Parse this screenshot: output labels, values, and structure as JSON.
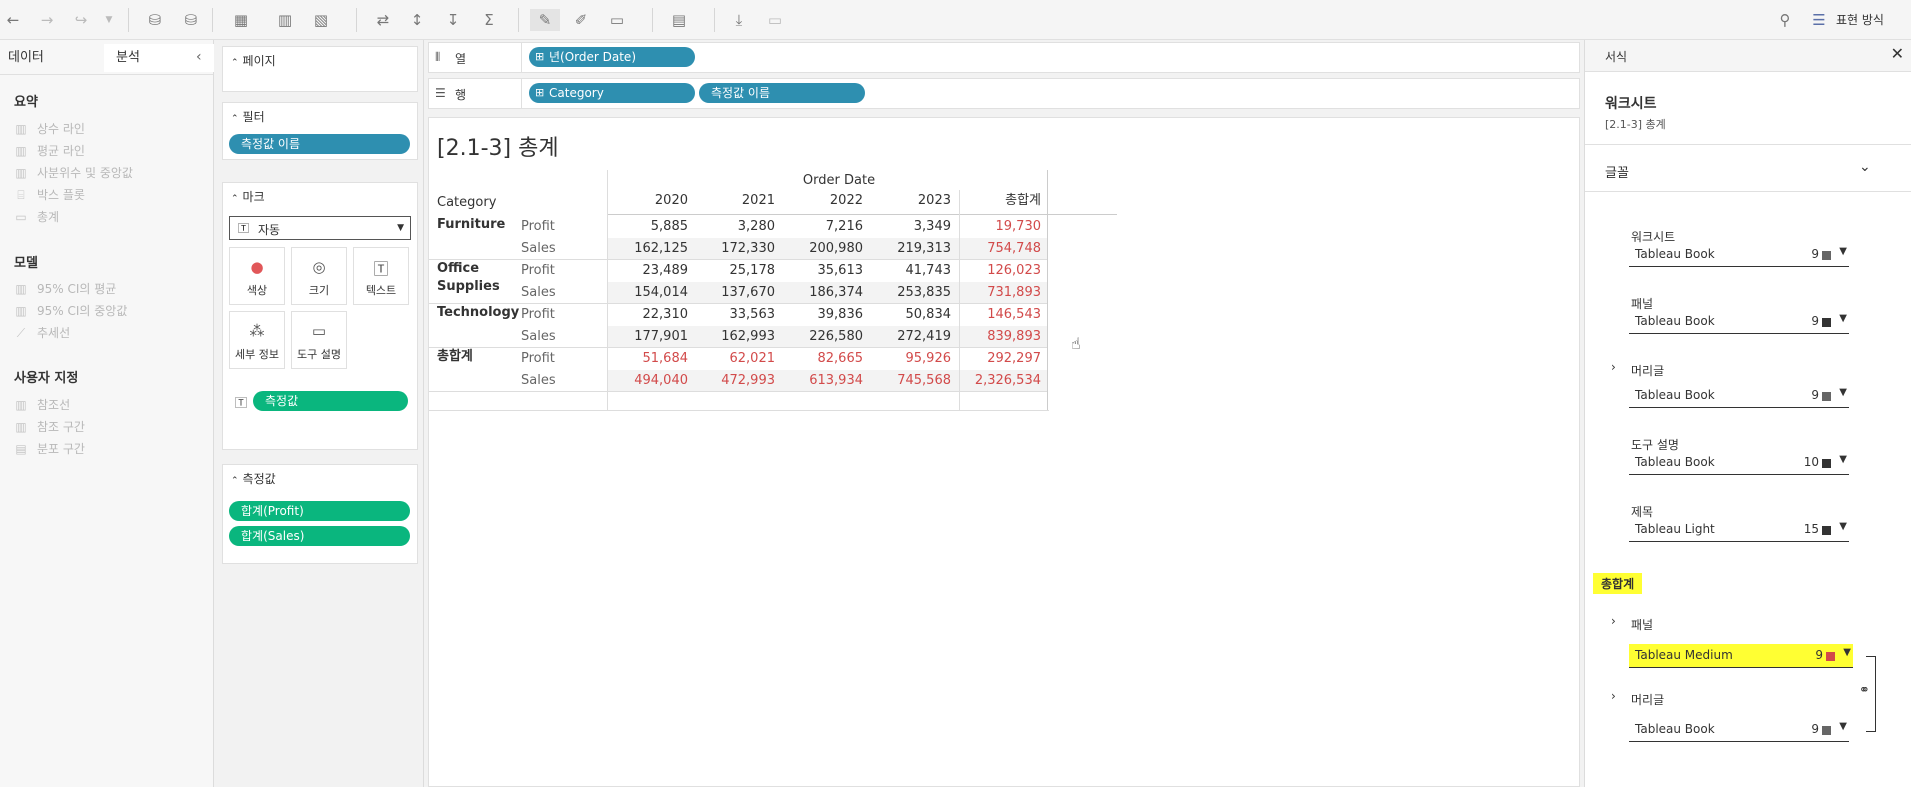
{
  "toolbar": {
    "right_label": "표현 방식"
  },
  "left_panel": {
    "tabs": [
      "데이터",
      "분석"
    ],
    "sections": [
      {
        "title": "요약",
        "items": [
          "상수 라인",
          "평균 라인",
          "사분위수 및 중앙값",
          "박스 플롯",
          "총계"
        ]
      },
      {
        "title": "모델",
        "items": [
          "95% CI의 평균",
          "95% CI의 중앙값",
          "추세선"
        ]
      },
      {
        "title": "사용자 지정",
        "items": [
          "참조선",
          "참조 구간",
          "분포 구간"
        ]
      }
    ]
  },
  "shelves": {
    "pages": "페이지",
    "filters": "필터",
    "filter_pill": "측정값 이름",
    "marks": "마크",
    "mark_type": "자동",
    "mark_buttons": [
      "색상",
      "크기",
      "텍스트",
      "세부 정보",
      "도구 설명"
    ],
    "mark_pill": "측정값",
    "measures": "측정값",
    "measure_pills": [
      "합계(Profit)",
      "합계(Sales)"
    ]
  },
  "canvas": {
    "columns_label": "열",
    "rows_label": "행",
    "column_pill": "년(Order Date)",
    "row_pills": [
      "Category",
      "측정값 이름"
    ],
    "title": "[2.1-3] 총계",
    "table": {
      "header_group": "Order Date",
      "row_header": "Category",
      "columns": [
        "2020",
        "2021",
        "2022",
        "2023",
        "총합계"
      ],
      "rows": [
        {
          "category": [
            "Furniture"
          ],
          "measures": [
            {
              "name": "Profit",
              "values": [
                "5,885",
                "3,280",
                "7,216",
                "3,349",
                "19,730"
              ]
            },
            {
              "name": "Sales",
              "values": [
                "162,125",
                "172,330",
                "200,980",
                "219,313",
                "754,748"
              ]
            }
          ]
        },
        {
          "category": [
            "Office",
            "Supplies"
          ],
          "measures": [
            {
              "name": "Profit",
              "values": [
                "23,489",
                "25,178",
                "35,613",
                "41,743",
                "126,023"
              ]
            },
            {
              "name": "Sales",
              "values": [
                "154,014",
                "137,670",
                "186,374",
                "253,835",
                "731,893"
              ]
            }
          ]
        },
        {
          "category": [
            "Technology"
          ],
          "measures": [
            {
              "name": "Profit",
              "values": [
                "22,310",
                "33,563",
                "39,836",
                "50,834",
                "146,543"
              ]
            },
            {
              "name": "Sales",
              "values": [
                "177,901",
                "162,993",
                "226,580",
                "272,419",
                "839,893"
              ]
            }
          ]
        },
        {
          "category": [
            "총합계"
          ],
          "measures": [
            {
              "name": "Profit",
              "values": [
                "51,684",
                "62,021",
                "82,665",
                "95,926",
                "292,297"
              ]
            },
            {
              "name": "Sales",
              "values": [
                "494,040",
                "472,993",
                "613,934",
                "745,568",
                "2,326,534"
              ]
            }
          ]
        }
      ]
    }
  },
  "format_panel": {
    "header": "서식",
    "sheet_title": "워크시트",
    "sheet_sub": "[2.1-3] 총계",
    "font_section": "글꼴",
    "entries": [
      {
        "label": "워크시트",
        "font": "Tableau Book",
        "size": "9"
      },
      {
        "label": "패널",
        "font": "Tableau Book",
        "size": "9"
      },
      {
        "label": "머리글",
        "font": "Tableau Book",
        "size": "9"
      },
      {
        "label": "도구 설명",
        "font": "Tableau Book",
        "size": "10"
      },
      {
        "label": "제목",
        "font": "Tableau Light",
        "size": "15"
      }
    ],
    "grand_total": "총합계",
    "total_entries": [
      {
        "label": "패널",
        "font": "Tableau Medium",
        "size": "9"
      },
      {
        "label": "머리글",
        "font": "Tableau Book",
        "size": "9"
      }
    ]
  },
  "colors": {
    "pill_blue": "#2e8fb0",
    "pill_green": "#0ab67e",
    "total_red": "#d24a4a",
    "highlight": "#ffff33"
  }
}
